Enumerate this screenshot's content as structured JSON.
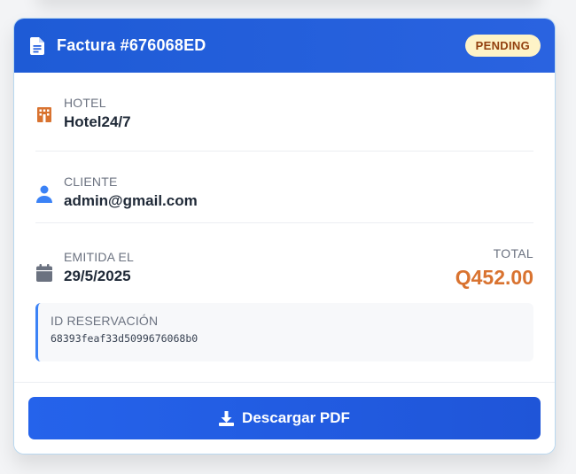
{
  "invoice": {
    "title": "Factura #676068ED",
    "status": "PENDING"
  },
  "hotel": {
    "label": "HOTEL",
    "value": "Hotel24/7"
  },
  "client": {
    "label": "CLIENTE",
    "value": "admin@gmail.com"
  },
  "issued": {
    "label": "EMITIDA EL",
    "value": "29/5/2025"
  },
  "total": {
    "label": "TOTAL",
    "value": "Q452.00"
  },
  "reservation": {
    "label": "ID RESERVACIÓN",
    "value": "68393feaf33d5099676068b0"
  },
  "actions": {
    "download_label": "Descargar PDF"
  },
  "colors": {
    "header": "#2563eb",
    "status_bg": "#fef3c7",
    "status_text": "#92400e",
    "total": "#d97330",
    "hotel_icon": "#d97330",
    "client_icon": "#3b82f6",
    "calendar_icon": "#6b7280"
  },
  "icons": {
    "header": "document-icon",
    "hotel": "building-icon",
    "client": "user-icon",
    "issued": "calendar-icon",
    "download": "download-icon"
  }
}
